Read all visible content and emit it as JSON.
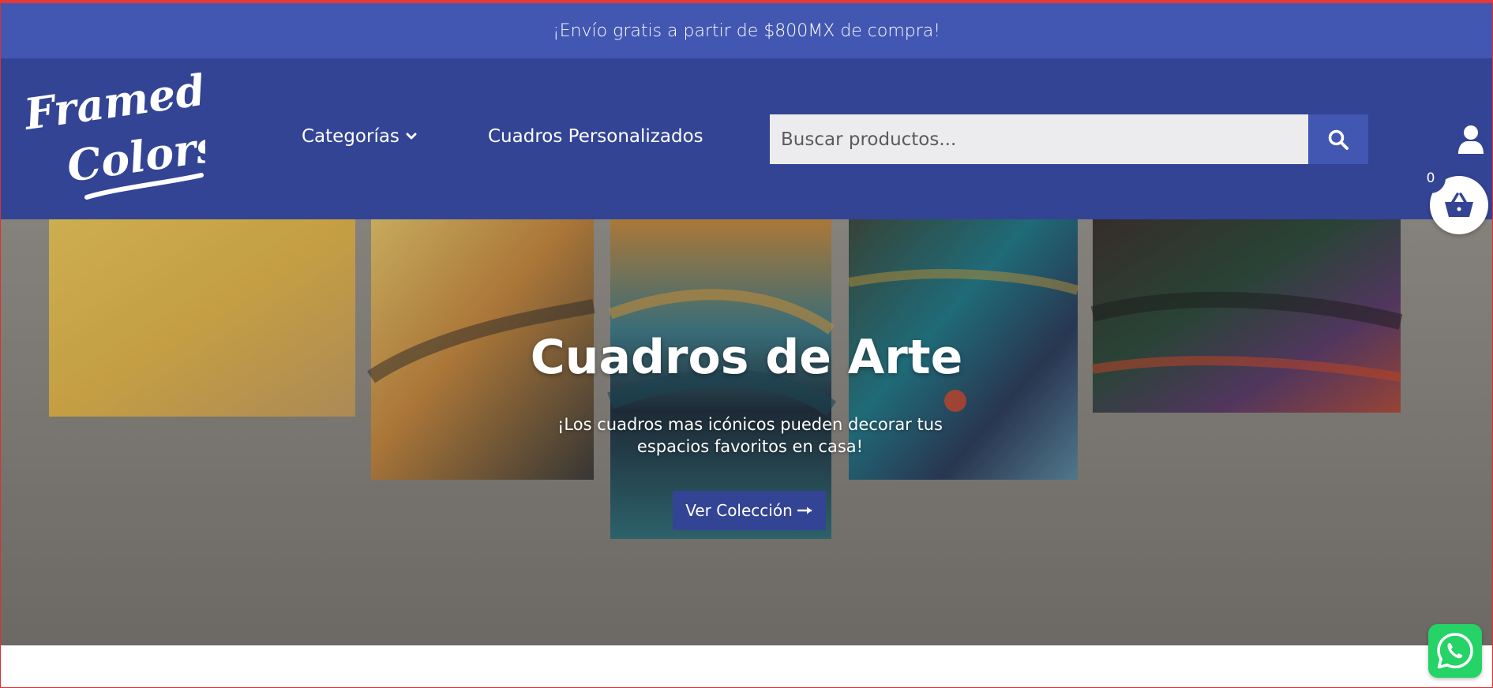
{
  "announcement": {
    "text": "¡Envío gratis a partir de $800MX de compra!"
  },
  "brand": {
    "logo_line1": "Framed",
    "logo_line2": "Colors"
  },
  "nav": {
    "categories_label": "Categorías",
    "custom_label": "Cuadros Personalizados"
  },
  "search": {
    "placeholder": "Buscar productos..."
  },
  "cart": {
    "count": "0"
  },
  "hero": {
    "title": "Cuadros de Arte",
    "subtitle": "¡Los cuadros mas icónicos pueden decorar tus espacios favoritos en casa!",
    "button_label": "Ver Colección"
  },
  "icons": {
    "search": "search-icon",
    "user": "user-icon",
    "cart": "basket-icon",
    "chevron": "chevron-down-icon",
    "arrow": "long-arrow-right-icon",
    "whatsapp": "whatsapp-icon"
  },
  "colors": {
    "announcement_bg": "#4257b2",
    "header_bg": "#334494",
    "accent": "#4257b2",
    "whatsapp": "#25d366"
  }
}
